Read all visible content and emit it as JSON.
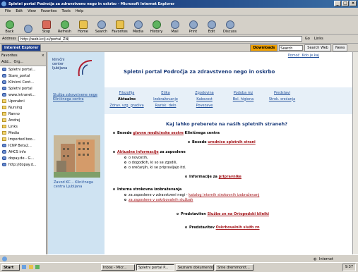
{
  "window": {
    "title": "Spletni portal Področja za zdravstveno nego in oskrbo - Microsoft Internet Explorer",
    "controls": [
      "_",
      "□",
      "×"
    ]
  },
  "menu": [
    "File",
    "Edit",
    "View",
    "Favorites",
    "Tools",
    "Help"
  ],
  "toolbar": [
    {
      "label": "Back",
      "icon": "back-arrow-icon"
    },
    {
      "label": "",
      "icon": "forward-arrow-icon"
    },
    {
      "label": "Stop",
      "icon": "stop-icon"
    },
    {
      "label": "Refresh",
      "icon": "refresh-icon"
    },
    {
      "label": "Home",
      "icon": "home-icon"
    },
    {
      "label": "Search",
      "icon": "search-icon"
    },
    {
      "label": "Favorites",
      "icon": "favorites-icon"
    },
    {
      "label": "Media",
      "icon": "media-icon"
    },
    {
      "label": "History",
      "icon": "history-icon"
    },
    {
      "label": "Mail",
      "icon": "mail-icon"
    },
    {
      "label": "Print",
      "icon": "print-icon"
    },
    {
      "label": "Edit",
      "icon": "edit-icon"
    },
    {
      "label": "Discuss",
      "icon": "discuss-icon"
    }
  ],
  "address": {
    "label": "Address",
    "value": "http://web.kclj.si/portal_ZN/",
    "go": "Go",
    "links": "Links"
  },
  "linksbar": {
    "explorer": "Internet Explorer",
    "downloads": "Downloads",
    "search_placeholder": "Search",
    "search_web": "Search Web",
    "news": "News"
  },
  "favorites": {
    "title": "Favorites",
    "add": "Add...",
    "organize": "Org...",
    "items": [
      {
        "label": "Spletni portal...",
        "type": "page"
      },
      {
        "label": "Stare_portal",
        "type": "page"
      },
      {
        "label": "Klinicni Cent...",
        "type": "page"
      },
      {
        "label": "Spletni portal",
        "type": "page"
      },
      {
        "label": "www.intranet...",
        "type": "page"
      },
      {
        "label": "Uporabni",
        "type": "folder"
      },
      {
        "label": "Nursing",
        "type": "folder"
      },
      {
        "label": "Ranno",
        "type": "folder"
      },
      {
        "label": "Andrej",
        "type": "folder"
      },
      {
        "label": "Links",
        "type": "folder"
      },
      {
        "label": "Media",
        "type": "folder"
      },
      {
        "label": "Imported boo...",
        "type": "folder"
      },
      {
        "label": "ICNP Beta2...",
        "type": "page"
      },
      {
        "label": "AHCS info",
        "type": "page"
      },
      {
        "label": "dopay.de - G...",
        "type": "page"
      },
      {
        "label": "http://dopay.d...",
        "type": "page"
      }
    ]
  },
  "page": {
    "logo": [
      "klinični",
      "center",
      "ljubljana"
    ],
    "left_link": "Služba zdravstvene nege Kliničnega centra",
    "photo_caption": "Zavod KC... Kliničnega centra Ljubljana",
    "title": "Spletni portal Področja za zdravstveno nego in oskrbo",
    "top_links": [
      "Pomoč",
      "Kdo je kaj"
    ],
    "grid": [
      [
        "Filozofija",
        "Etika",
        "Zgodovina",
        "Podoba mz",
        "Predstavi"
      ],
      [
        "Aktualno",
        "Izobraževanje",
        "Kakovost",
        "Bol. higiena",
        "Strok. srečanja"
      ],
      [
        "Zdrav. vzg. gradiva",
        "Razisk. delo",
        "Povezave",
        "",
        ""
      ]
    ],
    "heading": "Kaj lahko preberete na naših spletnih straneh?",
    "item1": {
      "pre": "Besede ",
      "link": "glavne medicinske sestre",
      "post": " Kliničnega centra"
    },
    "item2": {
      "pre": "Besede ",
      "link": "urednice spletnih strani"
    },
    "item3": {
      "link": "Aktualne informacije",
      "post": " za zaposlene",
      "subs": [
        "o novostih,",
        "o dogodkih, ki so se zgodili,",
        "o srečanjih, ki se pripravljajo itd."
      ]
    },
    "item4": {
      "pre": "Informacije za ",
      "link": "pripravnike"
    },
    "item5": {
      "pre": "Interna strokovna izobraževanja",
      "subs": [
        {
          "pre": "za zaposlene v zdravstveni negi - ",
          "link": "katalog internih strokovnih izobraževanj"
        },
        {
          "pre": "",
          "link": "za zaposlene v oskrbovalnih službah"
        }
      ]
    },
    "item6": {
      "pre": "Predstavitev ",
      "link": "Službe zn na Ortopedski kliniki"
    },
    "item7": {
      "pre": "Predstavitev ",
      "link": "Oskrbovalnih služb zn"
    }
  },
  "status": {
    "zone": "Internet"
  },
  "taskbar": {
    "start": "Start",
    "tasks": [
      "Inbox - Micr...",
      "Spletni portal P...",
      "Seznam dokumentov",
      "Srne dremmontt..."
    ],
    "clock": "9:37"
  }
}
